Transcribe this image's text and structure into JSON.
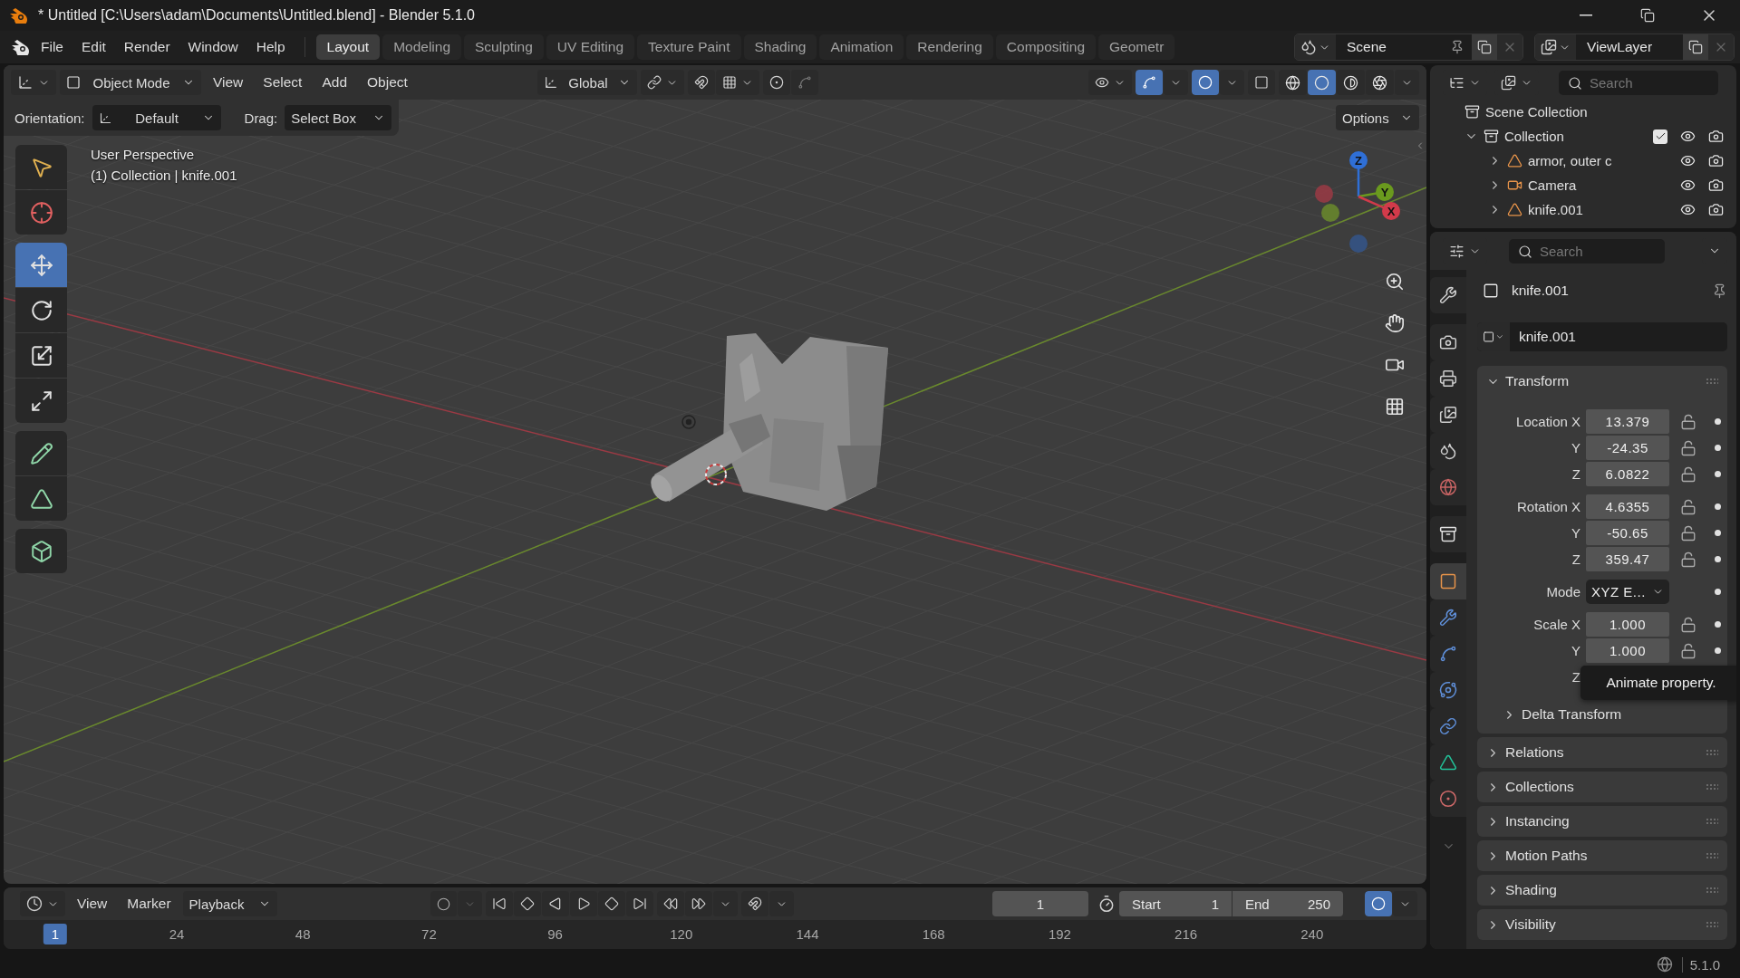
{
  "title_bar": {
    "title": "* Untitled [C:\\Users\\adam\\Documents\\Untitled.blend] - Blender 5.1.0"
  },
  "menu": [
    "File",
    "Edit",
    "Render",
    "Window",
    "Help"
  ],
  "workspaces": [
    {
      "label": "Layout",
      "selected": true
    },
    {
      "label": "Modeling",
      "selected": false
    },
    {
      "label": "Sculpting",
      "selected": false
    },
    {
      "label": "UV Editing",
      "selected": false
    },
    {
      "label": "Texture Paint",
      "selected": false
    },
    {
      "label": "Shading",
      "selected": false
    },
    {
      "label": "Animation",
      "selected": false
    },
    {
      "label": "Rendering",
      "selected": false
    },
    {
      "label": "Compositing",
      "selected": false
    },
    {
      "label": "Geometr",
      "selected": false
    }
  ],
  "scene": "Scene",
  "view_layer": "ViewLayer",
  "viewport_header": {
    "mode": "Object Mode",
    "menus": [
      "View",
      "Select",
      "Add",
      "Object"
    ],
    "orientation": "Global",
    "snap_on": false,
    "proportional_on": false,
    "gizmos_on": true,
    "overlays_on": true,
    "xray_on": false,
    "shading": [
      {
        "kind": "wireframe",
        "selected": false
      },
      {
        "kind": "solid",
        "selected": true
      },
      {
        "kind": "material",
        "selected": false
      },
      {
        "kind": "rendered",
        "selected": false
      }
    ]
  },
  "tool_settings": {
    "orientation_label": "Orientation:",
    "orientation": "Default",
    "drag_label": "Drag:",
    "drag": "Select Box",
    "options": "Options"
  },
  "viewport": {
    "view_name": "User Perspective",
    "context": "(1) Collection | knife.001",
    "axes": [
      "Z",
      "Y",
      "X"
    ]
  },
  "tool_groups": [
    {
      "tools": [
        {
          "kind": "select",
          "selected": false
        },
        {
          "kind": "cursor",
          "selected": false
        }
      ]
    },
    {
      "tools": [
        {
          "kind": "move",
          "selected": true
        },
        {
          "kind": "rotate",
          "selected": false
        },
        {
          "kind": "scale",
          "selected": false
        },
        {
          "kind": "transform",
          "selected": false
        }
      ]
    },
    {
      "tools": [
        {
          "kind": "annotate",
          "selected": false
        },
        {
          "kind": "measure",
          "selected": false
        }
      ]
    },
    {
      "tools": [
        {
          "kind": "add_cube",
          "selected": false
        }
      ]
    }
  ],
  "outliner": {
    "search_placeholder": "Search",
    "root": "Scene Collection",
    "collections": [
      {
        "label": "Collection",
        "expanded": true,
        "checked": true,
        "visible": true,
        "children": [
          {
            "label": "armor, outer c",
            "kind": "mesh",
            "visible": true
          },
          {
            "label": "Camera",
            "kind": "camera",
            "visible": true
          },
          {
            "label": "knife.001",
            "kind": "mesh",
            "visible": true
          }
        ]
      }
    ]
  },
  "properties": {
    "search_placeholder": "Search",
    "tabs": [
      {
        "kind": "tool",
        "selected": false
      },
      {
        "kind": "render",
        "selected": false
      },
      {
        "kind": "output",
        "selected": false
      },
      {
        "kind": "view_layer",
        "selected": false
      },
      {
        "kind": "scene",
        "selected": false
      },
      {
        "kind": "world",
        "selected": false
      },
      {
        "kind": "collection",
        "selected": false
      },
      {
        "kind": "object",
        "selected": true
      },
      {
        "kind": "modifiers",
        "selected": false
      },
      {
        "kind": "particles",
        "selected": false
      },
      {
        "kind": "physics",
        "selected": false
      },
      {
        "kind": "constraints",
        "selected": false
      },
      {
        "kind": "data",
        "selected": false
      },
      {
        "kind": "material",
        "selected": false
      }
    ],
    "object_name": "knife.001",
    "name_field": "knife.001",
    "transform": {
      "title": "Transform",
      "expanded": true,
      "groups": [
        {
          "rows": [
            {
              "label": "Location X",
              "value": "13.379"
            },
            {
              "label": "Y",
              "value": "-24.35"
            },
            {
              "label": "Z",
              "value": "6.0822"
            }
          ]
        },
        {
          "rows": [
            {
              "label": "Rotation X",
              "value": "4.6355"
            },
            {
              "label": "Y",
              "value": "-50.65"
            },
            {
              "label": "Z",
              "value": "359.47"
            }
          ]
        },
        {
          "rows": [
            {
              "label": "Mode",
              "value": "XYZ E...",
              "kind": "dropdown"
            }
          ]
        },
        {
          "rows": [
            {
              "label": "Scale X",
              "value": "1.000"
            },
            {
              "label": "Y",
              "value": "1.000"
            },
            {
              "label": "Z"
            }
          ]
        }
      ],
      "delta": "Delta Transform"
    },
    "panels": [
      "Relations",
      "Collections",
      "Instancing",
      "Motion Paths",
      "Shading",
      "Visibility"
    ]
  },
  "tooltip": "Animate property.",
  "timeline": {
    "menus": [
      "View",
      "Marker"
    ],
    "playback": "Playback",
    "auto_keying": false,
    "current_frame": "1",
    "start_label": "Start",
    "start": "1",
    "end_label": "End",
    "end": "250",
    "sync_on": true,
    "ruler": [
      {
        "label": "1",
        "current": true
      },
      {
        "label": "24",
        "current": false
      },
      {
        "label": "48",
        "current": false
      },
      {
        "label": "72",
        "current": false
      },
      {
        "label": "96",
        "current": false
      },
      {
        "label": "120",
        "current": false
      },
      {
        "label": "144",
        "current": false
      },
      {
        "label": "168",
        "current": false
      },
      {
        "label": "192",
        "current": false
      },
      {
        "label": "216",
        "current": false
      },
      {
        "label": "240",
        "current": false
      }
    ]
  },
  "status_bar": {
    "version": "5.1.0"
  }
}
